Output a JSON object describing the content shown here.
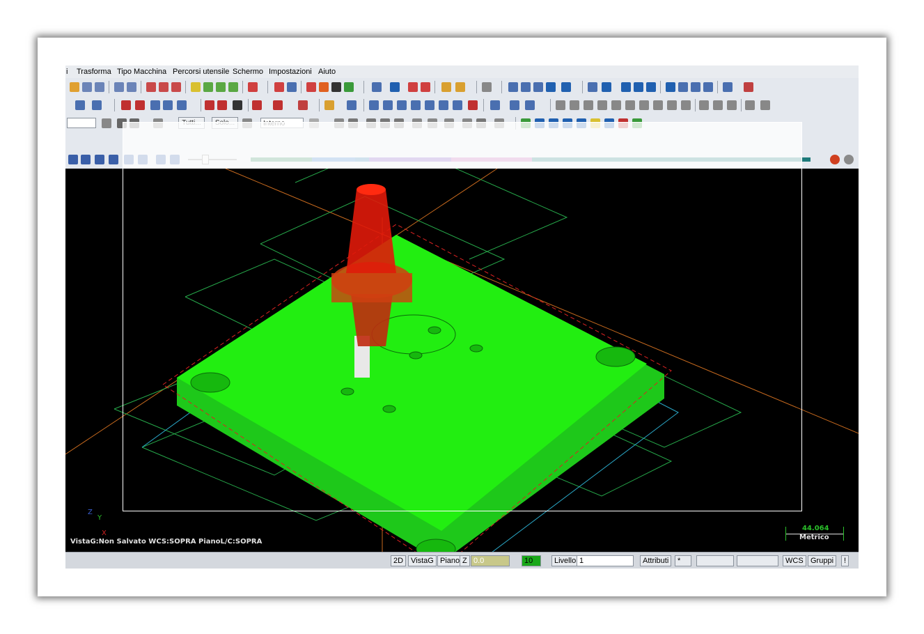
{
  "menu": [
    "i",
    "Trasforma",
    "Tipo Macchina",
    "Percorsi utensile",
    "Schermo",
    "Impostazioni",
    "Aiuto"
  ],
  "toolbar3": {
    "tutti_label": "Tutti...",
    "solo_label": "Solo...",
    "interno_value": "Interno"
  },
  "viewport": {
    "info_text": "VistaG:Non Salvato   WCS:SOPRA   PianoL/C:SOPRA",
    "axis_x": "X",
    "axis_y": "Y",
    "axis_z": "Z",
    "scale_value": "44.064",
    "scale_unit": "Metrico"
  },
  "statusbar": {
    "btn_2d": "2D",
    "btn_vistag": "VistaG",
    "btn_piano": "Piano",
    "z_label": "Z",
    "z_value": "0.0",
    "color_value": "10",
    "livello_label": "Livello",
    "livello_value": "1",
    "attributi_label": "Attributi",
    "wcs_label": "WCS",
    "gruppi_label": "Gruppi",
    "excl": "!"
  },
  "colors": {
    "part": "#22ee11",
    "tool": "#dd2200",
    "background": "#000000"
  }
}
